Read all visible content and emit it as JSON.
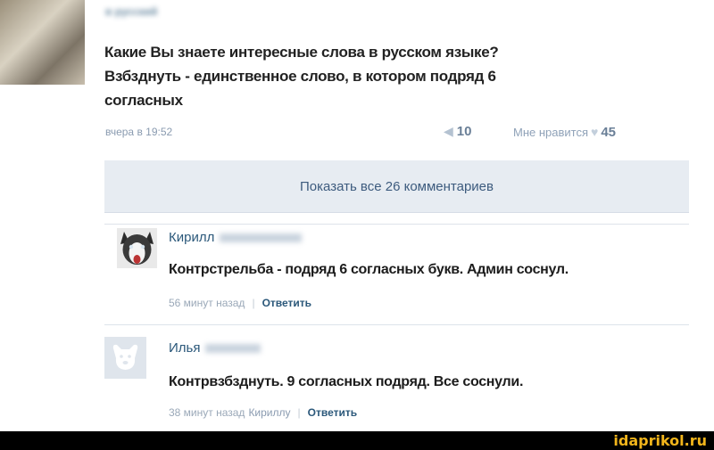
{
  "post": {
    "author": "в русский",
    "text": "Какие Вы знаете интересные слова в русском языке?\nВзбзднуть - единственное слово, в котором подряд 6\nсогласных",
    "time": "вчера в 19:52",
    "shares": "10",
    "like_label": "Мне нравится",
    "likes": "45"
  },
  "show_all_label": "Показать все 26 комментариев",
  "comments": [
    {
      "name": "Кирилл",
      "text": "Контрстрельба - подряд 6 согласных букв. Админ соснул.",
      "time": "56 минут назад",
      "reply": "Ответить"
    },
    {
      "name": "Илья",
      "text": "Контрвзбзднуть. 9 согласных подряд. Все соснули.",
      "time": "38 минут назад",
      "reply_to": "Кириллу",
      "reply": "Ответить"
    }
  ],
  "watermark": "idaprikol.ru",
  "colors": {
    "link": "#2b587a",
    "show_all_bg": "#e7ecf2",
    "watermark": "#f2b51b"
  }
}
